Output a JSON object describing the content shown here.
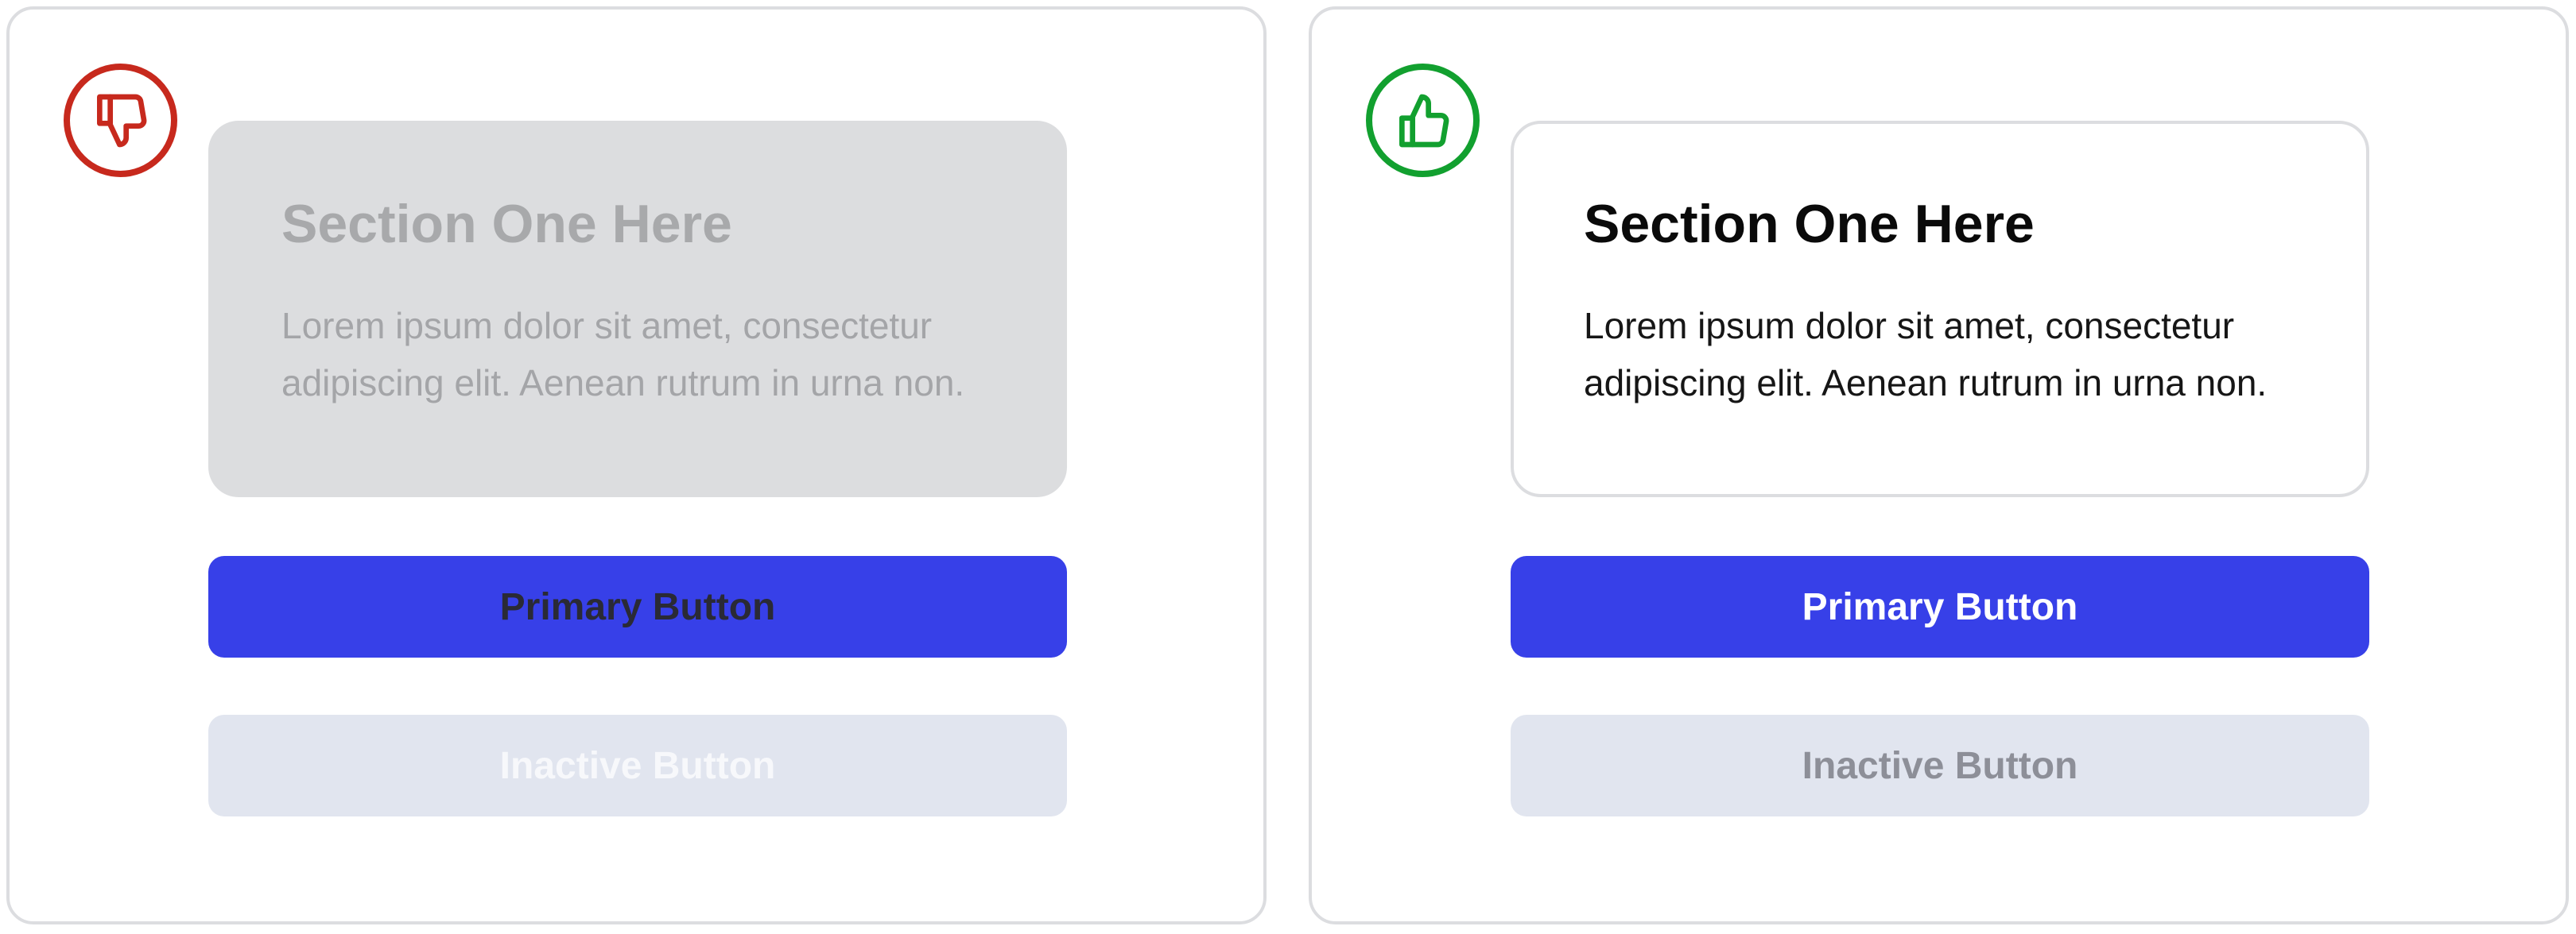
{
  "panels": {
    "bad": {
      "verdict_icon": "thumbs-down-icon",
      "accent_color": "#c7291d",
      "card": {
        "title": "Section One Here",
        "body": "Lorem ipsum dolor sit amet, consectetur adipiscing elit. Aenean rutrum in urna non."
      },
      "primary_button": "Primary Button",
      "inactive_button": "Inactive Button"
    },
    "good": {
      "verdict_icon": "thumbs-up-icon",
      "accent_color": "#12a02f",
      "card": {
        "title": "Section One Here",
        "body": "Lorem ipsum dolor sit amet, consectetur adipiscing elit. Aenean rutrum in urna non."
      },
      "primary_button": "Primary Button",
      "inactive_button": "Inactive Button"
    }
  },
  "colors": {
    "primary": "#3740e8",
    "inactive": "#e1e5ef"
  }
}
